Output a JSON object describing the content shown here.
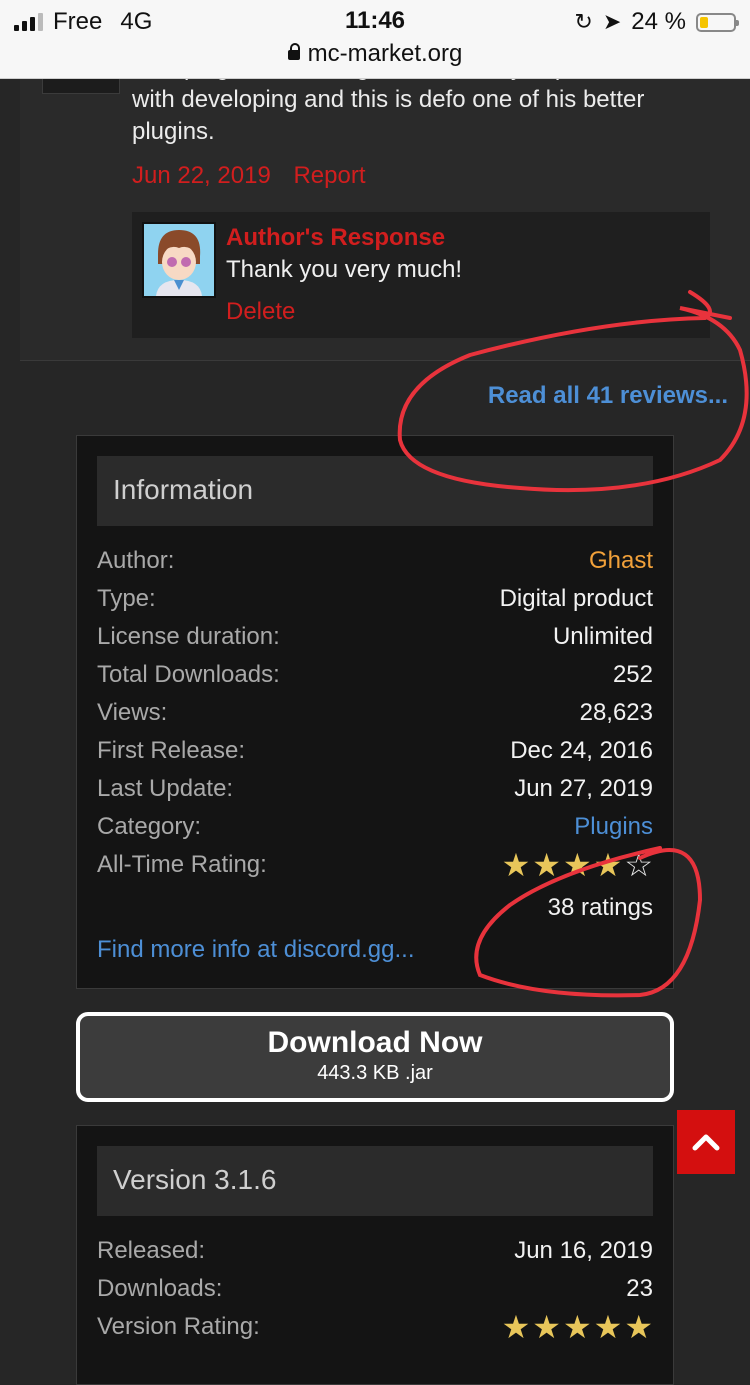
{
  "status_bar": {
    "carrier": "Free",
    "network": "4G",
    "time": "11:46",
    "url": "mc-market.org",
    "battery": "24 %",
    "battery_level": 0.24,
    "battery_color": "#f5c400"
  },
  "review": {
    "text_cut": "This plugin is amazing, Ghast is very experienced",
    "text_lines": [
      "with developing and this is defo one of his better",
      "plugins."
    ],
    "date": "Jun 22, 2019",
    "report_label": "Report",
    "response": {
      "title": "Author's Response",
      "text": "Thank you very much!",
      "delete_label": "Delete"
    }
  },
  "read_all_link": "Read all 41 reviews...",
  "information": {
    "heading": "Information",
    "rows": [
      {
        "label": "Author:",
        "value": "Ghast"
      },
      {
        "label": "Type:",
        "value": "Digital product"
      },
      {
        "label": "License duration:",
        "value": "Unlimited"
      },
      {
        "label": "Total Downloads:",
        "value": "252"
      },
      {
        "label": "Views:",
        "value": "28,623"
      },
      {
        "label": "First Release:",
        "value": "Dec 24, 2016"
      },
      {
        "label": "Last Update:",
        "value": "Jun 27, 2019"
      },
      {
        "label": "Category:",
        "value": "Plugins"
      },
      {
        "label": "All-Time Rating:",
        "value": ""
      }
    ],
    "rating_stars": 4,
    "ratings_count": "38 ratings",
    "more_info_link": "Find more info at discord.gg..."
  },
  "download": {
    "title": "Download Now",
    "subtitle": "443.3 KB .jar"
  },
  "version": {
    "heading": "Version 3.1.6",
    "rows": [
      {
        "label": "Released:",
        "value": "Jun 16, 2019"
      },
      {
        "label": "Downloads:",
        "value": "23"
      },
      {
        "label": "Version Rating:",
        "value": ""
      }
    ],
    "rating_stars": 5
  },
  "colors": {
    "accent_red": "#d11e1e",
    "link_blue": "#4d8fd6",
    "author_orange": "#f2a13a",
    "star_gold": "#e8c65a",
    "annotation_red": "#e8333c"
  }
}
